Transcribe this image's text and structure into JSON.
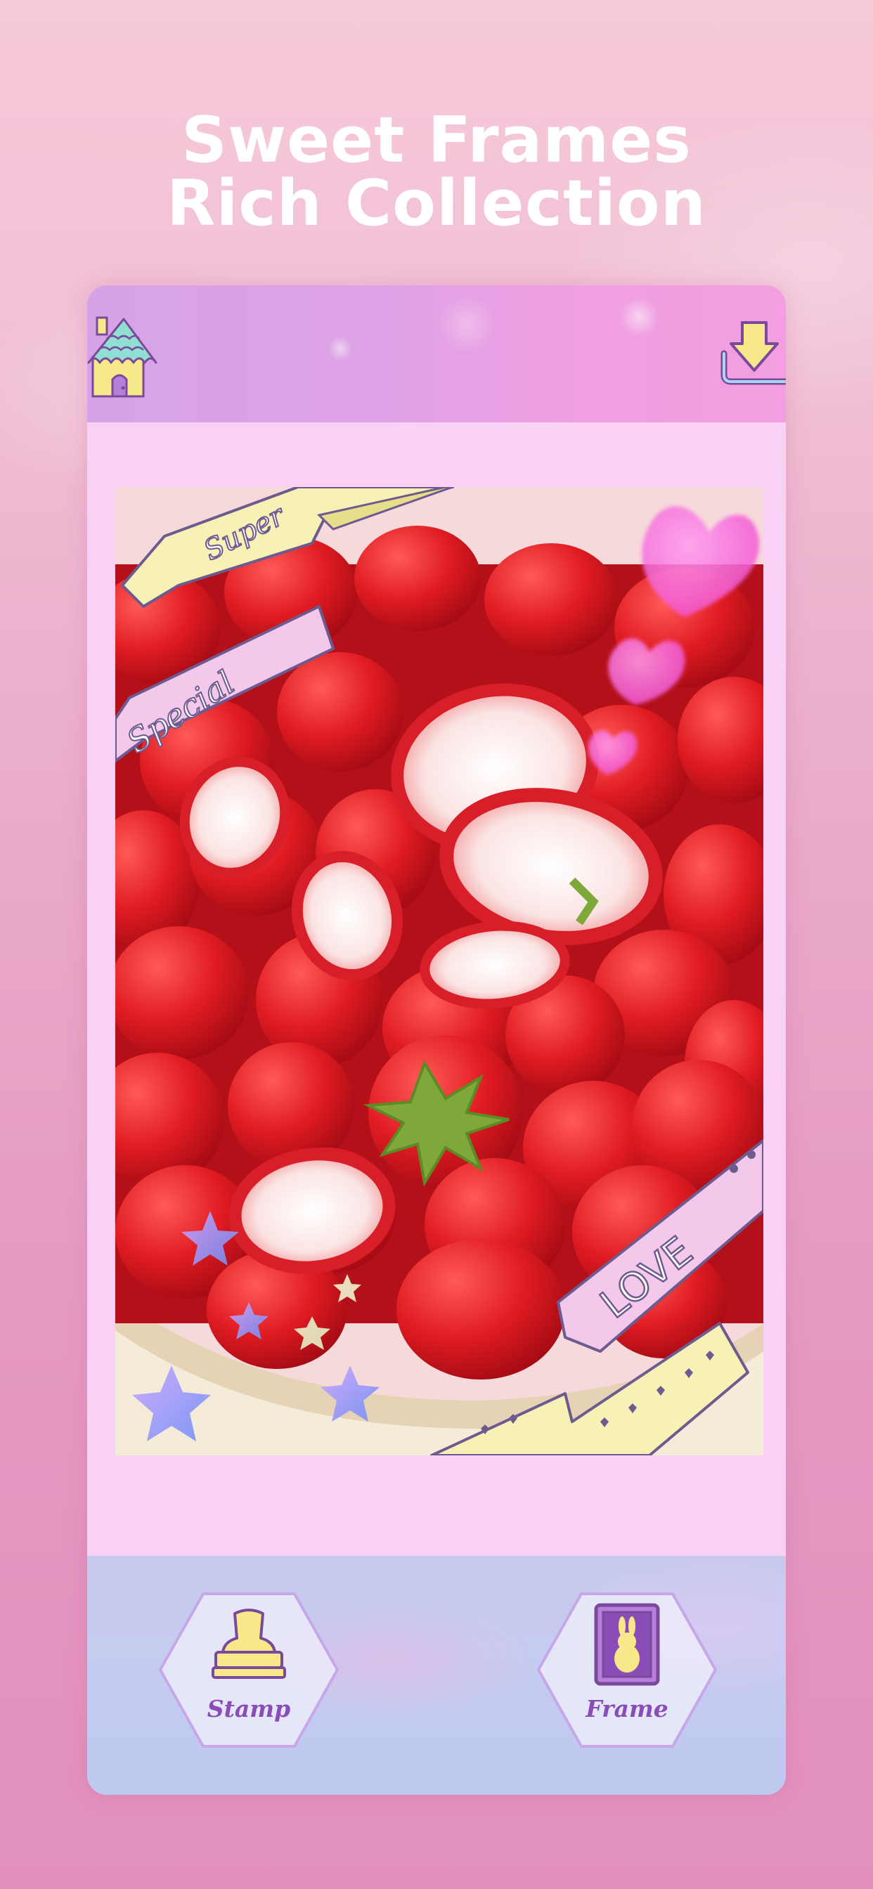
{
  "headline": {
    "line1": "Sweet Frames",
    "line2": "Rich Collection"
  },
  "toolbar": {
    "home_icon": "house-icon",
    "save_icon": "download-tray-icon"
  },
  "photo": {
    "ribbon_super": "Super",
    "ribbon_special": "Special",
    "ribbon_love": "LOVE"
  },
  "bottom_bar": {
    "stamp_label": "Stamp",
    "stamp_icon": "stamp-icon",
    "frame_label": "Frame",
    "frame_icon": "bunny-frame-icon"
  },
  "colors": {
    "background_top": "#f7cadb",
    "background_bottom": "#e28fbc",
    "panel": "#f9d1f5",
    "label_purple": "#8a4db8",
    "ribbon_yellow": "#f7f1b5",
    "ribbon_pink": "#f3c8ea"
  }
}
